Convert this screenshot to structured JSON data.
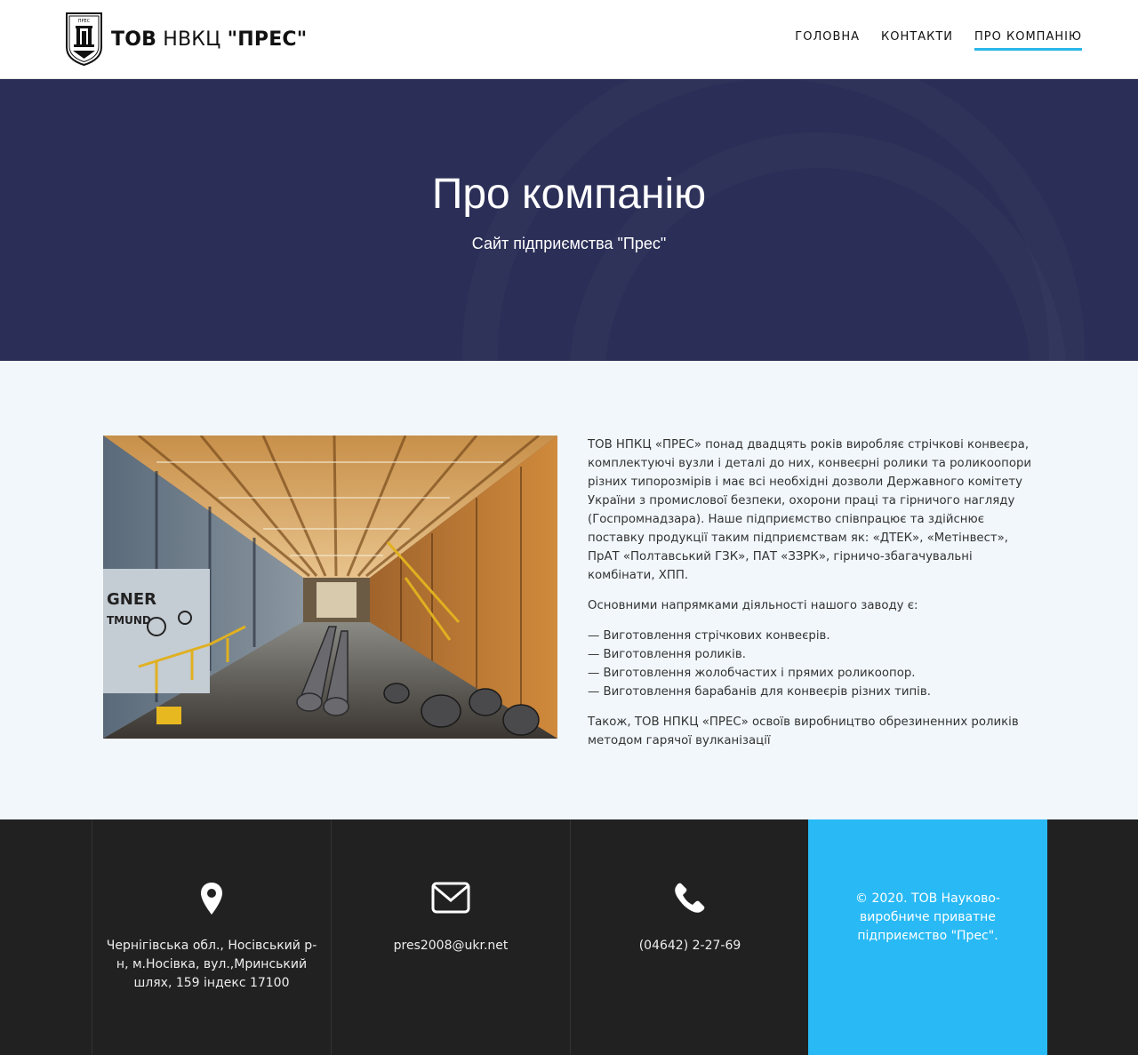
{
  "header": {
    "logo_bold": "ТОВ",
    "logo_middle": " НВКЦ ",
    "logo_end": "\"ПРЕС\"",
    "logo_icon": "pres-emblem-icon",
    "nav": [
      {
        "label": "ГОЛОВНА",
        "active": false
      },
      {
        "label": "КОНТАКТИ",
        "active": false
      },
      {
        "label": "ПРО КОМПАНІЮ",
        "active": true
      }
    ],
    "accent_color": "#29b6e8"
  },
  "hero": {
    "title": "Про компанію",
    "subtitle": "Сайт підприємства \"Прес\"",
    "background": "#2b2f57"
  },
  "about": {
    "image": "factory-hall-photo",
    "paragraph1": "ТОВ НПКЦ «ПРЕС» понад двадцять років виробляє стрічкові конвеєра, комплектуючі вузли і деталі до них, конвеєрні ролики та роликоопори різних типорозмірів і має всі необхідні дозволи Державного комітету України з промислової безпеки, охорони праці та гірничого нагляду (Госпромнадзара). Наше підприємство співпрацює та здійснює поставку продукції таким підприємствам як: «ДТЕК», «Метінвест», ПрАТ «Полтавський ГЗК», ПАТ «ЗЗРК», гірничо-збагачувальні комбінати, ХПП.",
    "paragraph2": "Основними напрямками діяльності нашого заводу є:",
    "list": [
      "— Виготовлення стрічкових конвеєрів.",
      "— Виготовлення роликів.",
      "— Виготовлення жолобчастих і прямих роликоопор.",
      "— Виготовлення барабанів для конвеєрів різних типів."
    ],
    "paragraph3": "Також, ТОВ НПКЦ «ПРЕС» освоїв виробництво обрезиненних роликів методом гарячої вулканізації"
  },
  "footer": {
    "address_icon": "location-pin-icon",
    "address": "Чернігівська обл., Носівський р-н, м.Носівка, вул.,Мринський шлях, 159 індекс 17100",
    "email_icon": "envelope-icon",
    "email": "pres2008@ukr.net",
    "phone_icon": "phone-icon",
    "phone": "(04642) 2-27-69",
    "copyright": "©  2020. ТОВ Науково-виробниче приватне підприємство \"Прес\".",
    "copyright_bg": "#29baf5",
    "background": "#212121"
  }
}
